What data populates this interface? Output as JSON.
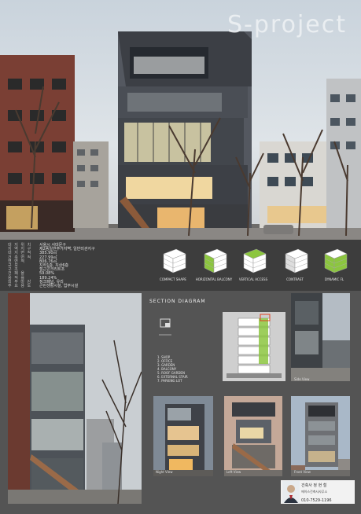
{
  "title": "S-project",
  "info": [
    {
      "label": "대 지 위 치",
      "value": "서울시 서대문구 __"
    },
    {
      "label": "지 역 지 구",
      "value": "제2종일반주거지역, 일반미관지구"
    },
    {
      "label": "대 지 면 적",
      "value": "385.90㎡"
    },
    {
      "label": "건 축 면 적",
      "value": "227.99㎡"
    },
    {
      "label": "연 면 적",
      "value": "806.76㎡"
    },
    {
      "label": "규 모",
      "value": "지하1층, 지상6층"
    },
    {
      "label": "구 조",
      "value": "철근콘크리트조"
    },
    {
      "label": "건 폐 율",
      "value": "59.08%"
    },
    {
      "label": "용 적 률",
      "value": "189.24%"
    },
    {
      "label": "외 부 마 감",
      "value": "징크패널, 유리"
    },
    {
      "label": "주 요 용 도",
      "value": "근린생활시설, 업무시설"
    }
  ],
  "diagrams": [
    {
      "label": "COMPACT SHAPE"
    },
    {
      "label": "HORIZONTAL BALCONY"
    },
    {
      "label": "VERTICAL ACCESS"
    },
    {
      "label": "CONTRAST"
    },
    {
      "label": "DYNAMIC FL"
    }
  ],
  "section": {
    "title": "SECTION DIAGRAM",
    "legend": [
      "1. SHOP",
      "2. OFFICE",
      "3. GARDEN",
      "4. BALCONY",
      "5. ROOF GARDEN",
      "6. EXTERNAL STAIR",
      "7. PARKING LOT"
    ]
  },
  "captions": {
    "night": "Night View",
    "left": "Left View",
    "front": "Front View",
    "side": "Side View"
  },
  "author": {
    "name": "건축사 정 현 철",
    "office": "에이스건축사사무소",
    "phone": "010-7529-1196"
  },
  "colors": {
    "accent_green": "#8cc63f",
    "panel_dark": "#3d3d3d",
    "panel_mid": "#545454"
  }
}
